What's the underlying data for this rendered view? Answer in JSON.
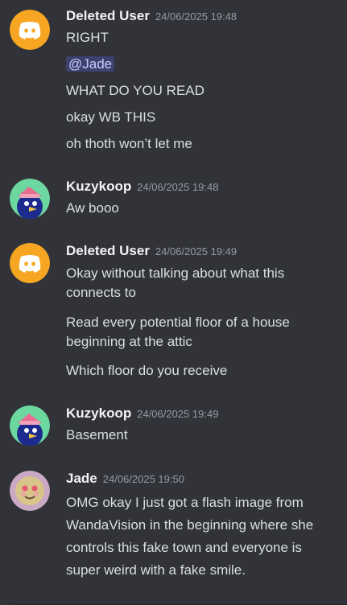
{
  "messages": [
    {
      "author": "Deleted User",
      "timestamp": "24/06/2025 19:48",
      "avatar": "discord-logo-icon",
      "lines": [
        "RIGHT",
        "@Jade",
        "WHAT DO YOU READ",
        "okay WB THIS",
        "oh thoth won’t let me"
      ]
    },
    {
      "author": "Kuzykoop",
      "timestamp": "24/06/2025 19:48",
      "avatar": "bird-character-icon",
      "lines": [
        "Aw booo"
      ]
    },
    {
      "author": "Deleted User",
      "timestamp": "24/06/2025 19:49",
      "avatar": "discord-logo-icon",
      "lines": [
        "Okay without talking about what this connects to",
        "Read every potential floor of a house beginning at the attic",
        "Which floor do you receive"
      ]
    },
    {
      "author": "Kuzykoop",
      "timestamp": "24/06/2025 19:49",
      "avatar": "bird-character-icon",
      "lines": [
        "Basement"
      ]
    },
    {
      "author": "Jade",
      "timestamp": "24/06/2025 19:50",
      "avatar": "face-portrait-icon",
      "lines": [
        "OMG okay I just got a flash image from WandaVision in the beginning where she controls this fake town and everyone is super weird with a fake smile."
      ]
    }
  ],
  "colors": {
    "background": "#313338",
    "discord_avatar": "#f6a623",
    "mention_bg": "#3c4270",
    "mention_text": "#c9cdfb"
  }
}
